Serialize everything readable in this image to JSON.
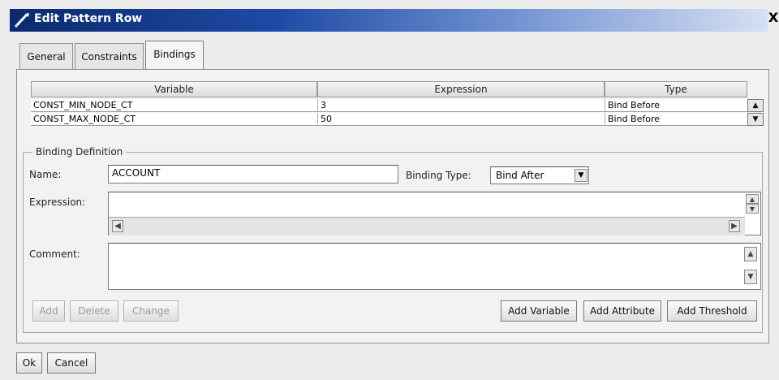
{
  "window": {
    "title": "Edit Pattern Row",
    "close_glyph": "X"
  },
  "tabs": [
    {
      "label": "General"
    },
    {
      "label": "Constraints"
    },
    {
      "label": "Bindings"
    }
  ],
  "bindings_table": {
    "columns": [
      "Variable",
      "Expression",
      "Type"
    ],
    "rows": [
      {
        "variable": "CONST_MIN_NODE_CT",
        "expression": "3",
        "type": "Bind Before"
      },
      {
        "variable": "CONST_MAX_NODE_CT",
        "expression": "50",
        "type": "Bind Before"
      }
    ]
  },
  "binding_definition": {
    "legend": "Binding Definition",
    "name_label": "Name:",
    "name_value": "ACCOUNT",
    "binding_type_label": "Binding Type:",
    "binding_type_value": "Bind After",
    "expression_label": "Expression:",
    "expression_value": "",
    "comment_label": "Comment:",
    "comment_value": ""
  },
  "buttons": {
    "add": "Add",
    "delete": "Delete",
    "change": "Change",
    "add_variable": "Add Variable",
    "add_attribute": "Add Attribute",
    "add_threshold": "Add Threshold",
    "ok": "Ok",
    "cancel": "Cancel"
  },
  "colors": {
    "titlebar_start": "#0b2a6e",
    "titlebar_end": "#d6e0f4",
    "panel_bg": "#f2f2f2"
  }
}
